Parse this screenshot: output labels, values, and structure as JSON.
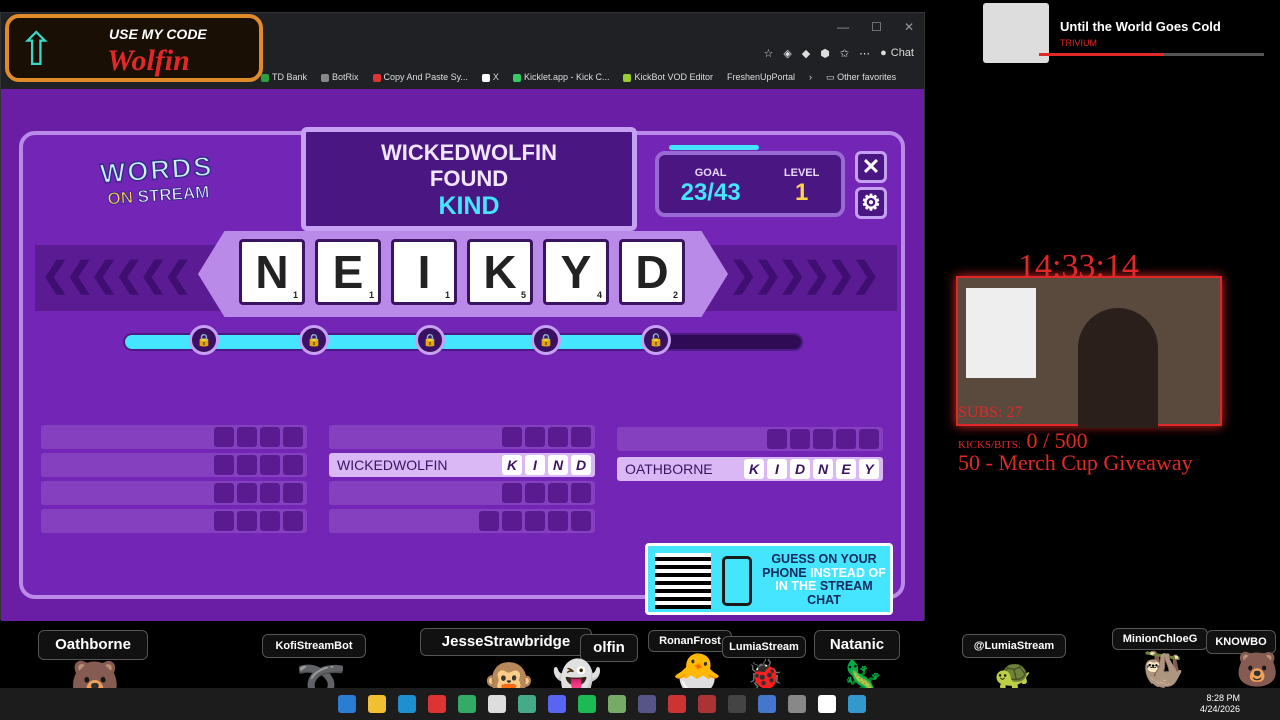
{
  "browser": {
    "chat_label": "Chat",
    "bookmarks": [
      "TD Bank",
      "BotRix",
      "Copy And Paste Sy...",
      "X",
      "Kicklet.app - Kick C...",
      "KickBot VOD Editor",
      "FreshenUpPortal"
    ],
    "other_favorites": "Other favorites"
  },
  "code_banner": {
    "line1": "USE MY CODE",
    "line2": "Wolfin"
  },
  "game": {
    "logo_words": "WORDS",
    "logo_on": "ON",
    "logo_stream": "STREAM",
    "found_line1": "WICKEDWOLFIN",
    "found_line2": "FOUND",
    "found_word": "KIND",
    "goal_label": "GOAL",
    "goal_value": "23/43",
    "level_label": "LEVEL",
    "level_value": "1",
    "goal_progress": 0.53,
    "close_symbol": "✕",
    "gear_symbol": "⚙",
    "tiles": [
      {
        "letter": "N",
        "points": "1"
      },
      {
        "letter": "E",
        "points": "1"
      },
      {
        "letter": "I",
        "points": "1"
      },
      {
        "letter": "K",
        "points": "5"
      },
      {
        "letter": "Y",
        "points": "4"
      },
      {
        "letter": "D",
        "points": "2"
      }
    ],
    "progress_fraction": 0.78,
    "found_rows": {
      "kind": {
        "player": "WICKEDWOLFIN",
        "letters": [
          "K",
          "I",
          "N",
          "D"
        ]
      },
      "kidney": {
        "player": "OATHBORNE",
        "letters": [
          "K",
          "I",
          "D",
          "N",
          "E",
          "Y"
        ]
      }
    },
    "qr_text_a": "GUESS ON YOUR PHONE",
    "qr_text_b": "INSTEAD OF IN THE",
    "qr_text_c": "STREAM CHAT"
  },
  "now_playing": {
    "title": "Until the World Goes Cold",
    "artist": "TRIVIUM"
  },
  "overlay": {
    "clock": "14:33:14",
    "subs": "SUBS: 27",
    "kicks_label": "KICKS/BITS:",
    "kicks_value": "0 / 500",
    "merch": "50 - Merch Cup Giveaway"
  },
  "chatters": [
    "Oathborne",
    "KofiStreamBot",
    "JesseStrawbridge",
    "olfin",
    "RonanFrost",
    "LumiaStream",
    "Natanic",
    "@LumiaStream",
    "MinionChloeG",
    "KNOWBO"
  ],
  "taskbar": {
    "time": "8:28 PM",
    "date": "4/24/2026"
  }
}
